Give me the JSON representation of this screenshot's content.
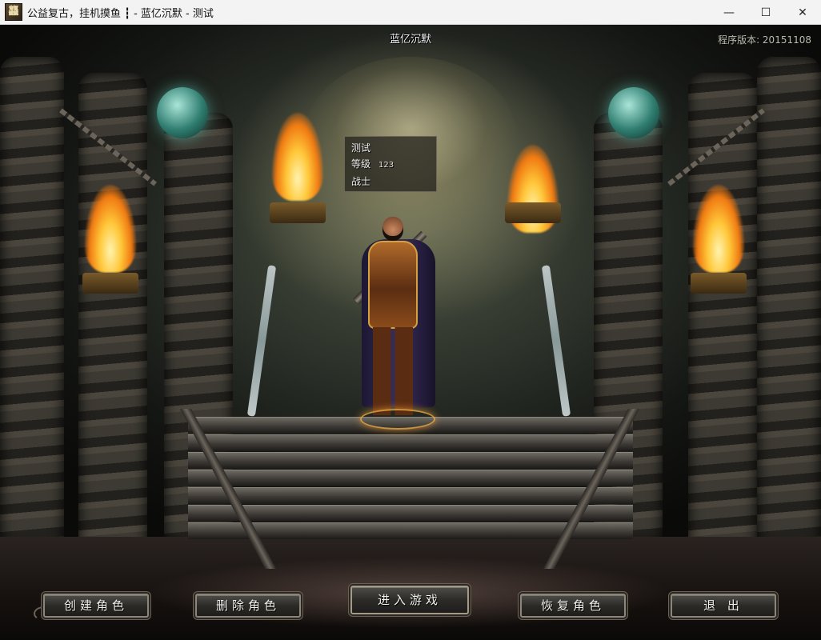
{
  "window": {
    "title": "公益复古，挂机摸鱼 ┇ - 蓝亿沉默 - 测试",
    "icon": "game-logo-icon",
    "icon_glyph": "龘",
    "controls": {
      "minimize": "—",
      "maximize": "☐",
      "close": "✕"
    }
  },
  "scene": {
    "server_name": "蓝亿沉默",
    "version_label": "程序版本: 20151108"
  },
  "character": {
    "name": "测试",
    "level_label": "等级",
    "level_value": "123",
    "class": "战士"
  },
  "buttons": {
    "create": "创建角色",
    "delete": "删除角色",
    "enter": "进入游戏",
    "restore": "恢复角色",
    "exit": "退  出"
  }
}
